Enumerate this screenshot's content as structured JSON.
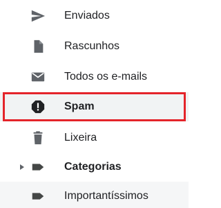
{
  "sidebar": {
    "items": [
      {
        "label": "Enviados",
        "icon": "send-icon"
      },
      {
        "label": "Rascunhos",
        "icon": "draft-icon"
      },
      {
        "label": "Todos os e-mails",
        "icon": "mail-icon"
      },
      {
        "label": "Spam",
        "icon": "spam-icon",
        "selected": true
      },
      {
        "label": "Lixeira",
        "icon": "trash-icon"
      },
      {
        "label": "Categorias",
        "icon": "label-icon",
        "expandable": true
      },
      {
        "label": "Importantíssimos",
        "icon": "label-icon"
      }
    ]
  },
  "colors": {
    "icon": "#5f6368",
    "text": "#202124",
    "highlight_border": "#e4242a",
    "selected_bg": "#f1f3f4"
  }
}
